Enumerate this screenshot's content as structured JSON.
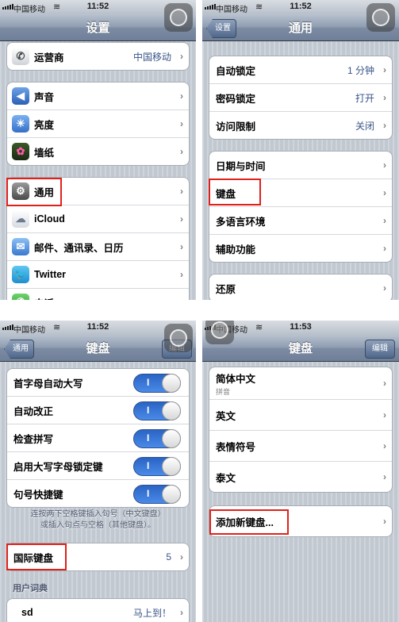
{
  "status_bars": [
    {
      "carrier": "中国移动",
      "time": "11:52"
    },
    {
      "carrier": "中国移动",
      "time": "11:52"
    },
    {
      "carrier": "中国移动",
      "time": "11:52"
    },
    {
      "carrier": "中国移动",
      "time": "11:53"
    }
  ],
  "settings": {
    "title": "设置",
    "group1": [
      {
        "label": "运营商",
        "value": "中国移动",
        "icon": "phone-icon"
      }
    ],
    "group2": [
      {
        "label": "声音",
        "icon": "speaker-icon"
      },
      {
        "label": "亮度",
        "icon": "sun-icon"
      },
      {
        "label": "墙纸",
        "icon": "flower-icon"
      }
    ],
    "group3": [
      {
        "label": "通用",
        "icon": "gear-icon"
      },
      {
        "label": "iCloud",
        "icon": "cloud-icon"
      },
      {
        "label": "邮件、通讯录、日历",
        "icon": "mail-icon"
      },
      {
        "label": "Twitter",
        "icon": "bird-icon"
      },
      {
        "label": "电话",
        "icon": "phone-icon"
      }
    ]
  },
  "general": {
    "back": "设置",
    "title": "通用",
    "group1": [
      {
        "label": "自动锁定",
        "value": "1 分钟"
      },
      {
        "label": "密码锁定",
        "value": "打开"
      },
      {
        "label": "访问限制",
        "value": "关闭"
      }
    ],
    "group2": [
      {
        "label": "日期与时间"
      },
      {
        "label": "键盘"
      },
      {
        "label": "多语言环境"
      },
      {
        "label": "辅助功能"
      }
    ],
    "group3": [
      {
        "label": "还原"
      }
    ]
  },
  "keyboard": {
    "back": "通用",
    "title": "键盘",
    "edit": "编辑",
    "toggles": [
      {
        "label": "首字母自动大写",
        "state": "I"
      },
      {
        "label": "自动改正",
        "state": "I"
      },
      {
        "label": "检查拼写",
        "state": "I"
      },
      {
        "label": "启用大写字母锁定键",
        "state": "I"
      },
      {
        "label": "句号快捷键",
        "state": "I"
      }
    ],
    "note_line1": "连按两下空格键插入句号（中文键盘）",
    "note_line2": "或插入句点与空格（其他键盘）。",
    "intl": {
      "label": "国际键盘",
      "value": "5"
    },
    "section": "用户词典",
    "dict": {
      "label": "sd",
      "value": "马上到！"
    }
  },
  "intl_keyboards": {
    "title": "键盘",
    "edit": "编辑",
    "list": [
      {
        "label": "简体中文",
        "sub": "拼音"
      },
      {
        "label": "英文"
      },
      {
        "label": "表情符号"
      },
      {
        "label": "泰文"
      }
    ],
    "add": "添加新键盘..."
  },
  "colors": {
    "highlight": "#e0211b",
    "toggle_on": "#2a64c4",
    "nav": "#6f7f98",
    "value_text": "#385487"
  }
}
